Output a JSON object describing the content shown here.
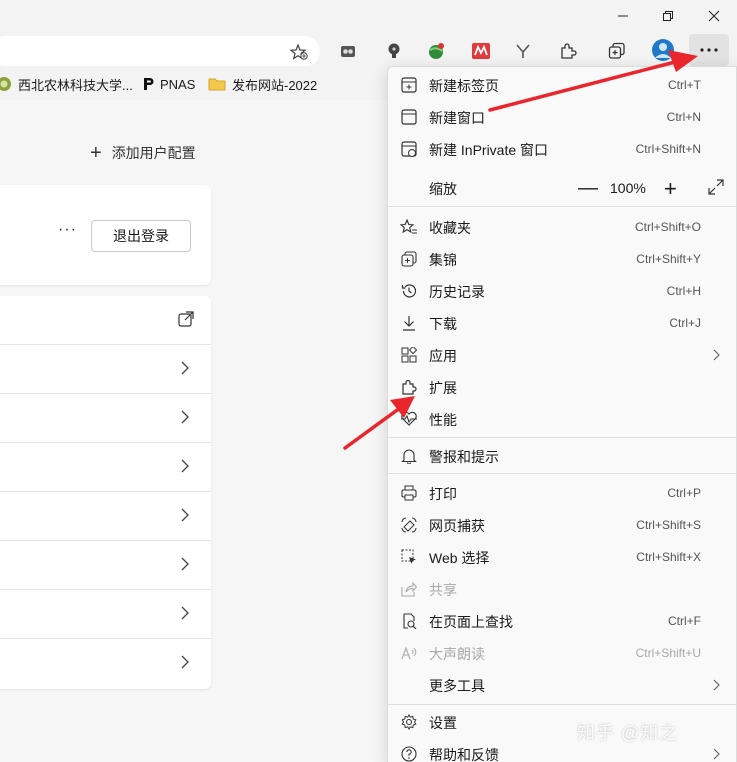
{
  "bookmarks": [
    {
      "label": "西北农林科技大学...",
      "icon": "university-logo-icon"
    },
    {
      "label": "PNAS",
      "icon": "pnas-logo-icon"
    },
    {
      "label": "发布网站-2022",
      "icon": "folder-icon"
    }
  ],
  "profile": {
    "add_label": "添加用户配置",
    "more_label": "···",
    "logout_label": "退出登录"
  },
  "menu": {
    "new_tab": {
      "label": "新建标签页",
      "shortcut": "Ctrl+T"
    },
    "new_window": {
      "label": "新建窗口",
      "shortcut": "Ctrl+N"
    },
    "new_inprivate": {
      "label": "新建 InPrivate 窗口",
      "shortcut": "Ctrl+Shift+N"
    },
    "zoom": {
      "label": "缩放",
      "minus": "—",
      "value": "100%",
      "plus": "+"
    },
    "favorites": {
      "label": "收藏夹",
      "shortcut": "Ctrl+Shift+O"
    },
    "collections": {
      "label": "集锦",
      "shortcut": "Ctrl+Shift+Y"
    },
    "history": {
      "label": "历史记录",
      "shortcut": "Ctrl+H"
    },
    "downloads": {
      "label": "下载",
      "shortcut": "Ctrl+J"
    },
    "apps": {
      "label": "应用"
    },
    "extensions": {
      "label": "扩展"
    },
    "performance": {
      "label": "性能"
    },
    "alerts": {
      "label": "警报和提示"
    },
    "print": {
      "label": "打印",
      "shortcut": "Ctrl+P"
    },
    "web_capture": {
      "label": "网页捕获",
      "shortcut": "Ctrl+Shift+S"
    },
    "web_select": {
      "label": "Web 选择",
      "shortcut": "Ctrl+Shift+X"
    },
    "share": {
      "label": "共享",
      "disabled": true
    },
    "find": {
      "label": "在页面上查找",
      "shortcut": "Ctrl+F"
    },
    "read_aloud": {
      "label": "大声朗读",
      "shortcut": "Ctrl+Shift+U",
      "disabled": true
    },
    "more_tools": {
      "label": "更多工具"
    },
    "settings": {
      "label": "设置"
    },
    "help": {
      "label": "帮助和反馈"
    }
  },
  "watermark": "知乎 @知之",
  "colors": {
    "annotation_arrow": "#e8262b",
    "menu_bg": "#f9f9f9",
    "page_bg": "#f6f6f6"
  }
}
